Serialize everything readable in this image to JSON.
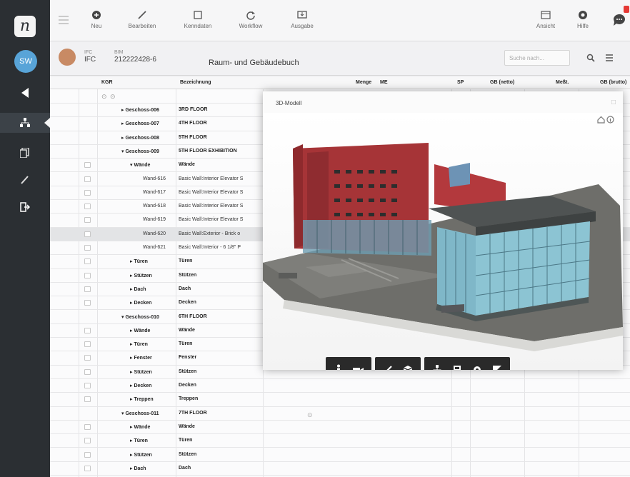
{
  "app": {
    "logo_letter": "n"
  },
  "rail": {
    "user_initials": "SW"
  },
  "toolbar": {
    "items": [
      {
        "label": "Neu"
      },
      {
        "label": "Bearbeiten"
      },
      {
        "label": "Kenndaten"
      },
      {
        "label": "Workflow"
      },
      {
        "label": "Ausgabe"
      }
    ],
    "right_items": [
      {
        "label": "Ansicht"
      },
      {
        "label": "Hilfe"
      }
    ]
  },
  "subheader": {
    "type_label": "IFC",
    "type_value": "IFC",
    "bim_label": "BIM",
    "bim_value": "212222428-6",
    "title": "Raum- und Gebäudebuch",
    "search_placeholder": "Suche nach..."
  },
  "table": {
    "columns": {
      "kgr": "KGR",
      "bezeichnung": "Bezeichnung",
      "menge": "Menge",
      "me": "ME",
      "sp": "SP",
      "gb_netto": "GB (netto)",
      "messtyp": "Meßt.",
      "gb_brutto": "GB (brutto)"
    },
    "rows": [
      {
        "kgr": "▸ Geschoss-006",
        "bez": "3RD FLOOR",
        "indent": 0,
        "bold": true,
        "cb": false
      },
      {
        "kgr": "▸ Geschoss-007",
        "bez": "4TH FLOOR",
        "indent": 0,
        "bold": true,
        "cb": false
      },
      {
        "kgr": "▸ Geschoss-008",
        "bez": "5TH FLOOR",
        "indent": 0,
        "bold": true,
        "cb": false
      },
      {
        "kgr": "▾ Geschoss-009",
        "bez": "5TH FLOOR EXHIBITION",
        "indent": 0,
        "bold": true,
        "cb": false
      },
      {
        "kgr": "▾ Wände",
        "bez": "Wände",
        "indent": 1,
        "bold": true,
        "cb": true
      },
      {
        "kgr": "Wand-616",
        "bez": "Basic Wall:Interior Elevator S",
        "indent": 2,
        "bold": false,
        "cb": true
      },
      {
        "kgr": "Wand-617",
        "bez": "Basic Wall:Interior Elevator S",
        "indent": 2,
        "bold": false,
        "cb": true
      },
      {
        "kgr": "Wand-618",
        "bez": "Basic Wall:Interior Elevator S",
        "indent": 2,
        "bold": false,
        "cb": true
      },
      {
        "kgr": "Wand-619",
        "bez": "Basic Wall:Interior Elevator S",
        "indent": 2,
        "bold": false,
        "cb": true
      },
      {
        "kgr": "Wand-620",
        "bez": "Basic Wall:Exterior - Brick o",
        "indent": 2,
        "bold": false,
        "cb": true,
        "sel": true
      },
      {
        "kgr": "Wand-621",
        "bez": "Basic Wall:Interior - 6 1/8\" P",
        "indent": 2,
        "bold": false,
        "cb": true
      },
      {
        "kgr": "▸ Türen",
        "bez": "Türen",
        "indent": 1,
        "bold": true,
        "cb": true
      },
      {
        "kgr": "▸ Stützen",
        "bez": "Stützen",
        "indent": 1,
        "bold": true,
        "cb": true
      },
      {
        "kgr": "▸ Dach",
        "bez": "Dach",
        "indent": 1,
        "bold": true,
        "cb": true
      },
      {
        "kgr": "▸ Decken",
        "bez": "Decken",
        "indent": 1,
        "bold": true,
        "cb": true
      },
      {
        "kgr": "▾ Geschoss-010",
        "bez": "6TH FLOOR",
        "indent": 0,
        "bold": true,
        "cb": false
      },
      {
        "kgr": "▸ Wände",
        "bez": "Wände",
        "indent": 1,
        "bold": true,
        "cb": true
      },
      {
        "kgr": "▸ Türen",
        "bez": "Türen",
        "indent": 1,
        "bold": true,
        "cb": true
      },
      {
        "kgr": "▸ Fenster",
        "bez": "Fenster",
        "indent": 1,
        "bold": true,
        "cb": true
      },
      {
        "kgr": "▸ Stützen",
        "bez": "Stützen",
        "indent": 1,
        "bold": true,
        "cb": true
      },
      {
        "kgr": "▸ Decken",
        "bez": "Decken",
        "indent": 1,
        "bold": true,
        "cb": true
      },
      {
        "kgr": "▸ Treppen",
        "bez": "Treppen",
        "indent": 1,
        "bold": true,
        "cb": true
      },
      {
        "kgr": "▾ Geschoss-011",
        "bez": "7TH FLOOR",
        "indent": 0,
        "bold": true,
        "cb": false
      },
      {
        "kgr": "▸ Wände",
        "bez": "Wände",
        "indent": 1,
        "bold": true,
        "cb": true
      },
      {
        "kgr": "▸ Türen",
        "bez": "Türen",
        "indent": 1,
        "bold": true,
        "cb": true
      },
      {
        "kgr": "▸ Stützen",
        "bez": "Stützen",
        "indent": 1,
        "bold": true,
        "cb": true
      },
      {
        "kgr": "▸ Dach",
        "bez": "Dach",
        "indent": 1,
        "bold": true,
        "cb": true
      }
    ]
  },
  "model_panel": {
    "title": "3D-Modell",
    "icons": [
      "home-icon",
      "info-icon",
      "walk-icon",
      "camera-icon",
      "measure-icon",
      "section-box-icon",
      "tree-icon",
      "properties-icon",
      "settings-icon",
      "fullscreen-icon"
    ]
  },
  "colors": {
    "rail": "#2b2f33",
    "avatar": "#58a4d8",
    "brick": "#b33a3e",
    "glass": "#7fb7c8",
    "toolbar_dark": "#2a2a2a",
    "notification": "#e53935"
  }
}
